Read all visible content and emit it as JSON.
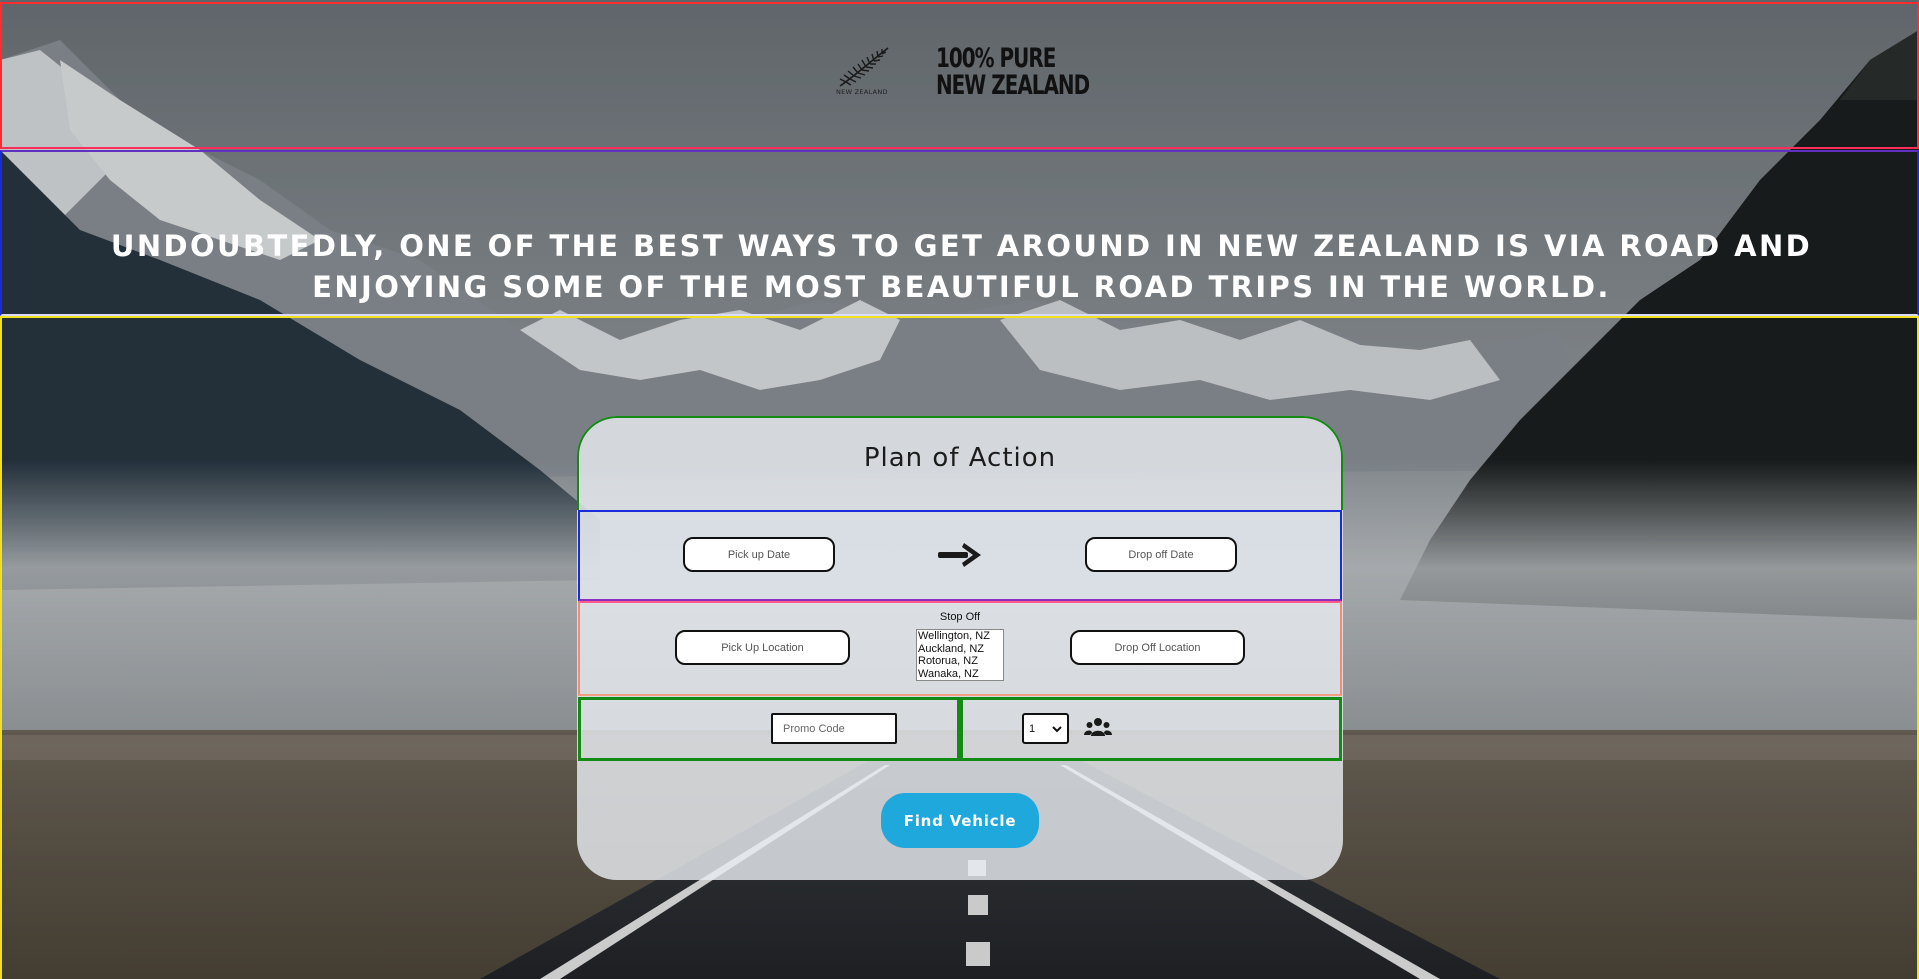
{
  "header": {
    "fern_caption": "NEW ZEALAND",
    "wordmark_line1": "100% PURE",
    "wordmark_line2": "NEW ZEALAND"
  },
  "hero": {
    "line1": "Undoubtedly, one of the best ways to get around in New Zealand is via road and",
    "line2": "enjoying some of the most beautiful road trips in the world."
  },
  "form": {
    "title": "Plan of Action",
    "pickup_date_placeholder": "Pick up Date",
    "dropoff_date_placeholder": "Drop off Date",
    "pickup_location_placeholder": "Pick Up Location",
    "dropoff_location_placeholder": "Drop Off Location",
    "stop_off_label": "Stop Off",
    "stop_off_options": [
      "Wellington, NZ",
      "Auckland, NZ",
      "Rotorua, NZ",
      "Wanaka, NZ"
    ],
    "promo_placeholder": "Promo Code",
    "passengers_value": "1",
    "submit_label": "Find Vehicle"
  },
  "icons": {
    "logo": "silver-fern-icon",
    "arrow": "arrow-right-icon",
    "passengers": "users-icon",
    "select": "chevron-down-icon"
  },
  "colors": {
    "button": "#1fa8dc",
    "header_border": "#ff2d2d",
    "hero_border": "#1a2bdc",
    "main_border": "#f0e020",
    "section_border": "#138a13"
  }
}
